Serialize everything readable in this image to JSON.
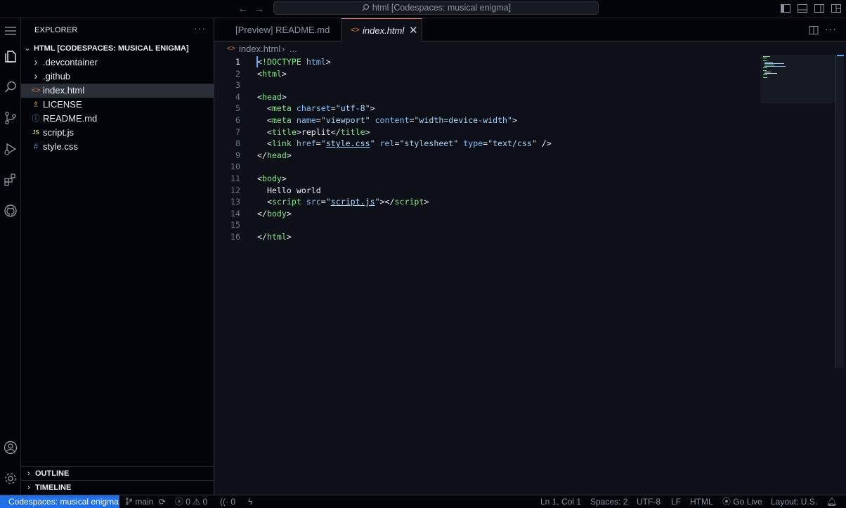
{
  "titlebar": {
    "command_center": "html [Codespaces: musical enigma]"
  },
  "sidebar": {
    "title": "EXPLORER",
    "more": "···",
    "workspace": "HTML [CODESPACES: MUSICAL ENIGMA]",
    "items": [
      {
        "label": ".devcontainer",
        "icon": "chevron-right-icon",
        "glyph": "›",
        "color": "#c9d1d9"
      },
      {
        "label": ".github",
        "icon": "chevron-right-icon",
        "glyph": "›",
        "color": "#c9d1d9"
      },
      {
        "label": "index.html",
        "icon": "html-file-icon",
        "glyph": "<>",
        "color": "#e37933"
      },
      {
        "label": "LICENSE",
        "icon": "license-file-icon",
        "glyph": "♗",
        "color": "#d4a72c"
      },
      {
        "label": "README.md",
        "icon": "info-file-icon",
        "glyph": "ⓘ",
        "color": "#519aba"
      },
      {
        "label": "script.js",
        "icon": "js-file-icon",
        "glyph": "JS",
        "color": "#cbcb41"
      },
      {
        "label": "style.css",
        "icon": "css-file-icon",
        "glyph": "#",
        "color": "#519aba"
      }
    ],
    "outline": "OUTLINE",
    "timeline": "TIMELINE"
  },
  "editor": {
    "tabs": [
      {
        "label": "[Preview] README.md",
        "active": false
      },
      {
        "label": "index.html",
        "active": true
      }
    ],
    "breadcrumb": {
      "file": "index.html",
      "more": "..."
    },
    "line_numbers": [
      "1",
      "2",
      "3",
      "4",
      "5",
      "6",
      "7",
      "8",
      "9",
      "10",
      "11",
      "12",
      "13",
      "14",
      "15",
      "16"
    ],
    "current_line": 1
  },
  "statusbar": {
    "remote": "Codespaces: musical enigma",
    "branch": "main",
    "errors": "0",
    "warnings": "0",
    "ports": "0",
    "cursor": "Ln 1, Col 1",
    "spaces": "Spaces: 2",
    "encoding": "UTF-8",
    "eol": "LF",
    "language": "HTML",
    "golive": "Go Live",
    "layout": "Layout: U.S."
  },
  "colors": {
    "accent": "#1f6feb",
    "tag": "#7ee787",
    "attribute": "#79c0ff",
    "string": "#a5d6ff"
  }
}
